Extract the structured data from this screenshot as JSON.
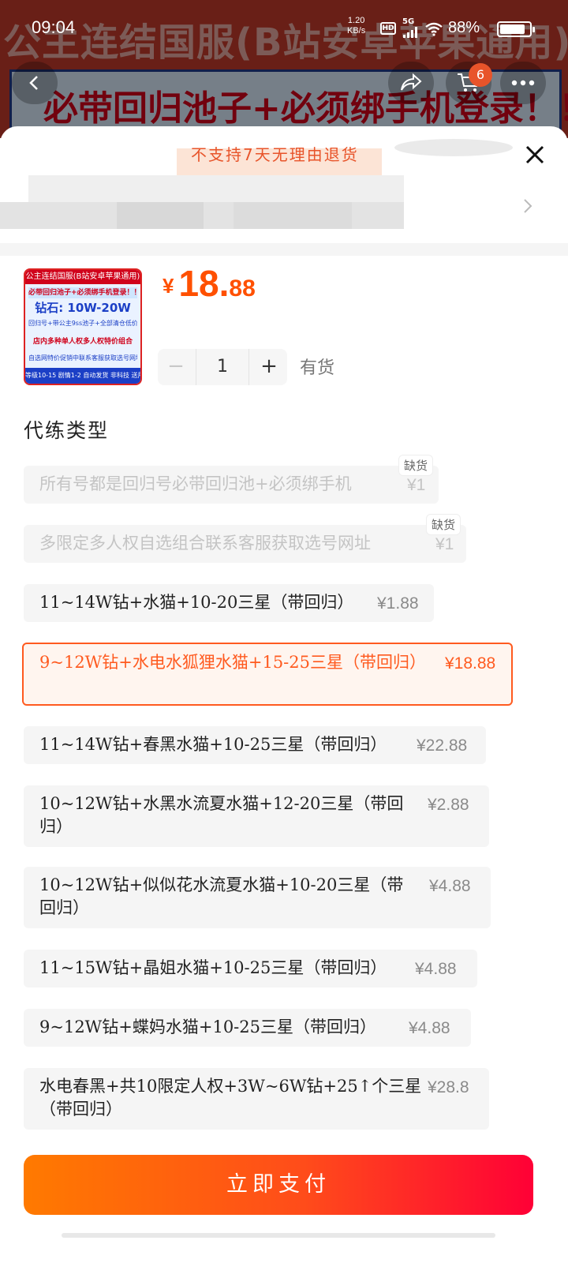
{
  "status_bar": {
    "time": "09:04",
    "net_speed_value": "1.20",
    "net_speed_unit": "KB/s",
    "hd": "HD",
    "network": "5G",
    "battery": "88%",
    "battery_level": 0.88
  },
  "background": {
    "title": "公主连结国服(B站安卓苹果通用)",
    "banner": "必带回归池子+必须绑手机登录！！",
    "cart_count": "6"
  },
  "sheet": {
    "notice": "不支持7天无理由退货",
    "product": {
      "thumbnail": {
        "header": "公主连结国服(B站安卓苹果通用)",
        "line1": "必带回归池子+必须绑手机登录！！！",
        "line2": "钻石:  10W-20W",
        "line3": "回归号+带公主9ss池子+全部清仓低价处理",
        "line4": "店内多种单人权多人权特价组合",
        "line5": "自选网特价促销中联系客服获取选号网址",
        "footer": "等级10-15 剧情1-2 自动发货 非科技 送用易帮用 可绑手机 安全"
      },
      "price_symbol": "¥",
      "price_int": "18.",
      "price_dec": "88",
      "quantity": "1",
      "qty_minus": "−",
      "qty_plus": "+",
      "stock_status": "有货"
    },
    "section_title": "代练类型",
    "options": [
      {
        "label": "所有号都是回归号必带回归池+必须绑手机",
        "price": "¥1",
        "tag": "缺货",
        "disabled": true
      },
      {
        "label": "多限定多人权自选组合联系客服获取选号网址",
        "price": "¥1",
        "tag": "缺货",
        "disabled": true
      },
      {
        "label": "11~14W钻+水猫+10-20三星（带回归）",
        "price": "¥1.88"
      },
      {
        "label": "9~12W钻+水电水狐狸水猫+15-25三星（带回归）",
        "price": "¥18.88",
        "selected": true
      },
      {
        "label": "11~14W钻+春黑水猫+10-25三星（带回归）",
        "price": "¥22.88"
      },
      {
        "label": "10~12W钻+水黑水流夏水猫+12-20三星（带回归）",
        "price": "¥2.88"
      },
      {
        "label": "10~12W钻+似似花水流夏水猫+10-20三星（带回归）",
        "price": "¥4.88"
      },
      {
        "label": "11~15W钻+晶姐水猫+10-25三星（带回归）",
        "price": "¥4.88"
      },
      {
        "label": "9~12W钻+蝶妈水猫+10-25三星（带回归）",
        "price": "¥4.88"
      },
      {
        "label": "水电春黑+共10限定人权+3W~6W钻+25↑个三星（带回归）",
        "price": "¥28.8"
      }
    ],
    "pay_button": "立即支付"
  },
  "colors": {
    "accent": "#ff5000",
    "selected_border": "#ff5a1f",
    "pay_start": "#ff7a00",
    "pay_end": "#ff0036"
  },
  "icons": [
    "back-icon",
    "share-icon",
    "cart-icon",
    "more-icon",
    "close-icon",
    "chevron-right-icon"
  ]
}
